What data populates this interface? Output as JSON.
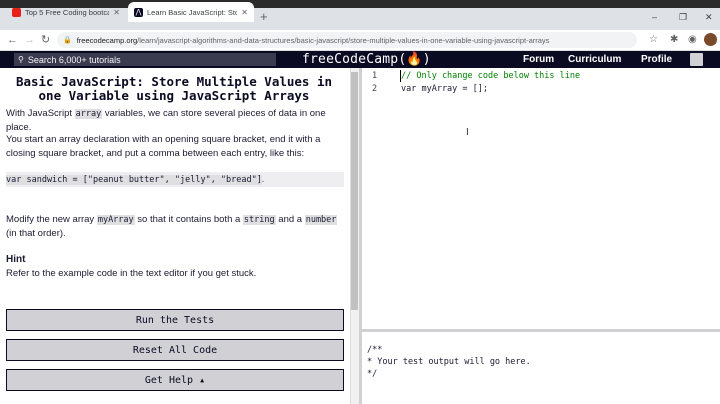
{
  "browser": {
    "tabs": [
      {
        "title": "Top 5 Free Coding bootcamps a...",
        "favicon_color": "#e62117"
      },
      {
        "title": "Learn Basic JavaScript: Store Mu...",
        "favicon_color": "#0a0a23"
      }
    ],
    "new_tab": "+",
    "window_controls": {
      "minimize": "–",
      "maximize": "❐",
      "close": "✕"
    },
    "nav": {
      "back": "←",
      "forward": "→",
      "reload": "↻"
    },
    "url_host": "freecodecamp.org",
    "url_path": "/learn/javascript-algorithms-and-data-structures/basic-javascript/store-multiple-values-in-one-variable-using-javascript-arrays",
    "right_icons": {
      "star": "☆",
      "extensions": "✱",
      "menu": "⋮"
    }
  },
  "fcc_nav": {
    "search_placeholder": "Search 6,000+ tutorials",
    "logo": "freeCodeCamp(🔥)",
    "links": [
      "Forum",
      "Curriculum",
      "Profile"
    ]
  },
  "lesson": {
    "title": "Basic JavaScript: Store Multiple Values in one Variable using JavaScript Arrays",
    "p1_before": "With JavaScript ",
    "p1_code": "array",
    "p1_after": " variables, we can store several pieces of data in one place.",
    "p2": "You start an array declaration with an opening square bracket, end it with a closing square bracket, and put a comma between each entry, like this:",
    "code_example": "var sandwich = [\"peanut butter\", \"jelly\", \"bread\"]",
    "code_example_after": ".",
    "p3_a": "Modify the new array ",
    "p3_code1": "myArray",
    "p3_b": " so that it contains both a ",
    "p3_code2": "string",
    "p3_c": " and a ",
    "p3_code3": "number",
    "p3_d": " (in that order).",
    "hint_heading": "Hint",
    "hint_text": "Refer to the example code in the text editor if you get stuck."
  },
  "buttons": {
    "run": "Run the Tests",
    "reset": "Reset All Code",
    "help": "Get Help ▴"
  },
  "editor": {
    "line_numbers": [
      "1",
      "2"
    ],
    "line1": "// Only change code below this line",
    "line2": "var myArray = [];"
  },
  "output": {
    "text": "/**\n* Your test output will go here.\n*/"
  }
}
